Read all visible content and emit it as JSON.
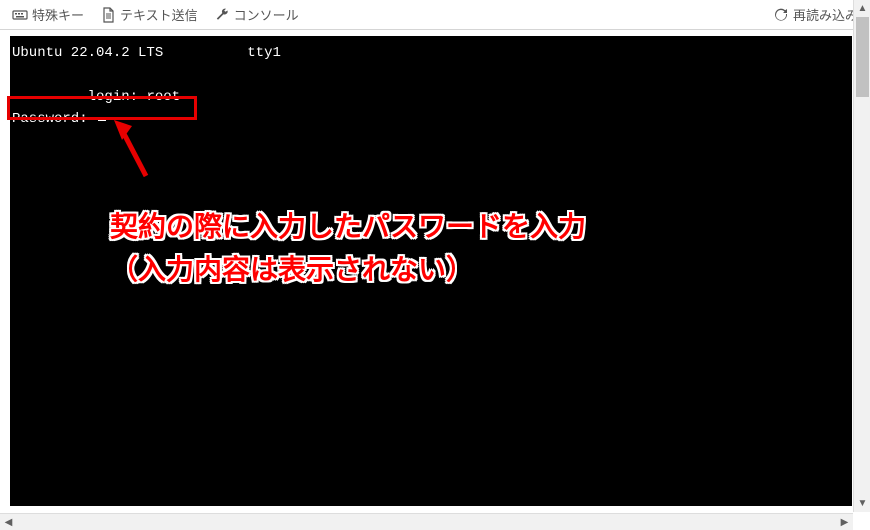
{
  "toolbar": {
    "special_keys": "特殊キー",
    "send_text": "テキスト送信",
    "console": "コンソール",
    "reload": "再読み込み"
  },
  "terminal": {
    "banner_prefix": "Ubuntu 22.04.2 LTS ",
    "banner_suffix": " tty1",
    "login_label": " login: ",
    "login_value": "root",
    "password_label": "Password: "
  },
  "annotation": {
    "line1": "契約の際に入力したパスワードを入力",
    "line2": "（入力内容は表示されない）"
  }
}
